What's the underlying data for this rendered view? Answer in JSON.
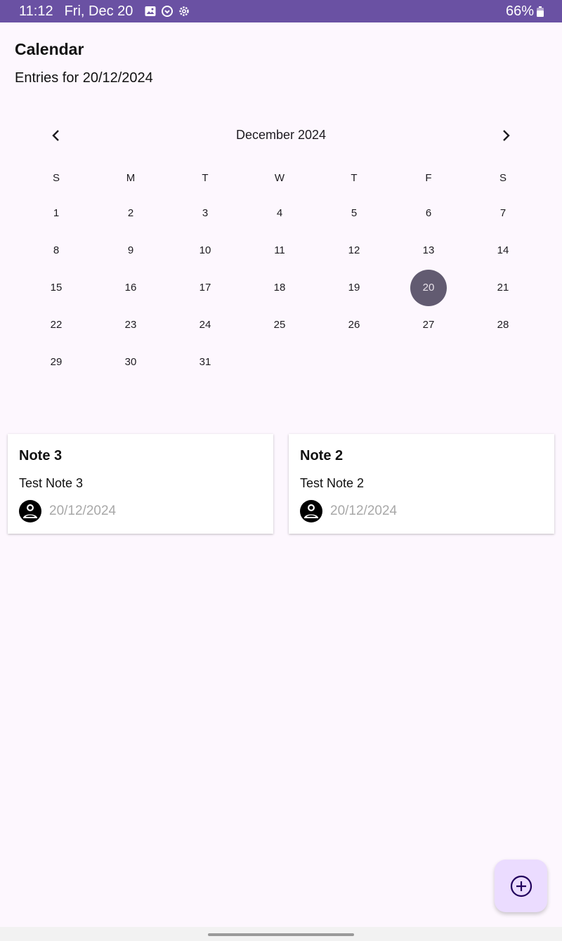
{
  "status_bar": {
    "time": "11:12",
    "date": "Fri, Dec 20",
    "battery": "66%",
    "icons": [
      "image-icon",
      "sync-icon",
      "settings-icon"
    ]
  },
  "header": {
    "title": "Calendar",
    "entries_label": "Entries for 20/12/2024"
  },
  "calendar": {
    "month_label": "December 2024",
    "weekdays": [
      "S",
      "M",
      "T",
      "W",
      "T",
      "F",
      "S"
    ],
    "days": [
      "1",
      "2",
      "3",
      "4",
      "5",
      "6",
      "7",
      "8",
      "9",
      "10",
      "11",
      "12",
      "13",
      "14",
      "15",
      "16",
      "17",
      "18",
      "19",
      "20",
      "21",
      "22",
      "23",
      "24",
      "25",
      "26",
      "27",
      "28",
      "29",
      "30",
      "31"
    ],
    "selected_day": "20",
    "selected_color": "#625b71"
  },
  "notes": [
    {
      "title": "Note 3",
      "body": "Test Note 3",
      "date": "20/12/2024"
    },
    {
      "title": "Note 2",
      "body": "Test Note 2",
      "date": "20/12/2024"
    }
  ],
  "colors": {
    "status_bar": "#6a51a3",
    "background": "#fdf7fe",
    "fab": "#ebdcff"
  }
}
